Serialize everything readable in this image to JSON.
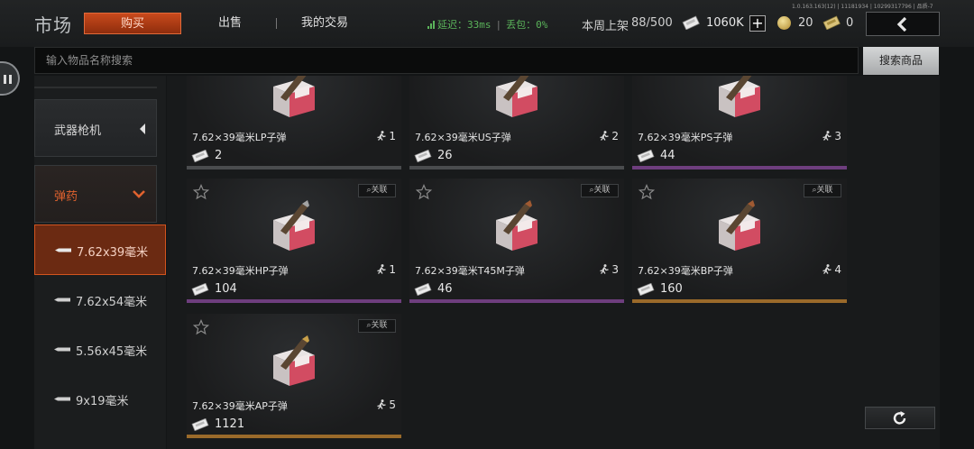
{
  "header": {
    "title": "市场",
    "tabs": {
      "buy": "购买",
      "sell": "出售",
      "trade": "我的交易"
    },
    "network": {
      "latency": "延迟：33ms",
      "loss": "丢包：0%"
    },
    "weekly": {
      "label": "本周上架",
      "value": "88/500"
    },
    "currency": {
      "money": "1060K",
      "plus": "+",
      "coins": "20",
      "tickets": "0"
    },
    "version": "1.0.163.163(12) | 11181934 | 10299317796 | 品质-7"
  },
  "search": {
    "placeholder": "输入物品名称搜索",
    "button": "搜索商品"
  },
  "sidebar": {
    "categories": [
      {
        "label": "武器枪机",
        "expanded": false
      },
      {
        "label": "弹药",
        "expanded": true
      }
    ],
    "subitems": [
      {
        "label": "7.62x39毫米",
        "active": true
      },
      {
        "label": "7.62x54毫米",
        "active": false
      },
      {
        "label": "5.56x45毫米",
        "active": false
      },
      {
        "label": "9x19毫米",
        "active": false
      }
    ]
  },
  "link_label": "关联",
  "items": [
    {
      "name": "7.62×39毫米LP子弹",
      "stock": "1",
      "price": "2",
      "rarity_color": "#4a4c4e",
      "tip": "#b07a3c"
    },
    {
      "name": "7.62×39毫米US子弹",
      "stock": "2",
      "price": "26",
      "rarity_color": "#4a4c4e",
      "tip": "#8a8a8a"
    },
    {
      "name": "7.62×39毫米PS子弹",
      "stock": "3",
      "price": "44",
      "rarity_color": "#6e3e7e",
      "tip": "#b9a368"
    },
    {
      "name": "7.62×39毫米HP子弹",
      "stock": "1",
      "price": "104",
      "rarity_color": "#6e3e7e",
      "tip": "#a3a3a3"
    },
    {
      "name": "7.62×39毫米T45M子弹",
      "stock": "3",
      "price": "46",
      "rarity_color": "#6e3e7e",
      "tip": "#a05a32"
    },
    {
      "name": "7.62×39毫米BP子弹",
      "stock": "4",
      "price": "160",
      "rarity_color": "#9a6a2a",
      "tip": "#a05a32"
    },
    {
      "name": "7.62×39毫米AP子弹",
      "stock": "5",
      "price": "1121",
      "rarity_color": "#9a6a2a",
      "tip": "#c8a04a"
    }
  ],
  "colors": {
    "accent": "#d2541e",
    "purple": "#6e3e7e",
    "gold": "#9a6a2a",
    "net_green": "#5ab35a"
  }
}
